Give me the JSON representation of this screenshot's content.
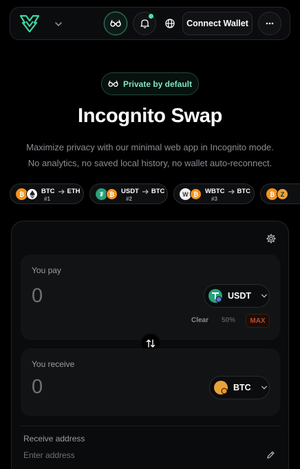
{
  "header": {
    "connect_label": "Connect Wallet"
  },
  "hero": {
    "badge": "Private by default",
    "title": "Incognito Swap",
    "subtitle_line1": "Maximize privacy with our minimal web app in Incognito mode.",
    "subtitle_line2": "No analytics, no saved local history, no wallet auto-reconnect."
  },
  "pairs": [
    {
      "from": "BTC",
      "to": "ETH",
      "rank": "#1"
    },
    {
      "from": "USDT",
      "to": "BTC",
      "rank": "#2"
    },
    {
      "from": "WBTC",
      "to": "BTC",
      "rank": "#3"
    }
  ],
  "swap": {
    "pay_label": "You pay",
    "pay_amount": "0",
    "pay_token": "USDT",
    "clear_label": "Clear",
    "half_label": "50%",
    "max_label": "MAX",
    "receive_label": "You receive",
    "receive_amount": "0",
    "receive_token": "BTC",
    "address_label": "Receive address",
    "address_placeholder": "Enter address"
  },
  "colors": {
    "accent_green": "#4ee0a8",
    "btc": "#f7931a",
    "usdt": "#26a17b",
    "max_red": "#c2492b"
  },
  "icons": [
    "logo",
    "chevron-down-icon",
    "incognito-glasses-icon",
    "bell-icon",
    "globe-icon",
    "more-icon",
    "gear-icon",
    "swap-arrows-icon",
    "pencil-icon"
  ]
}
